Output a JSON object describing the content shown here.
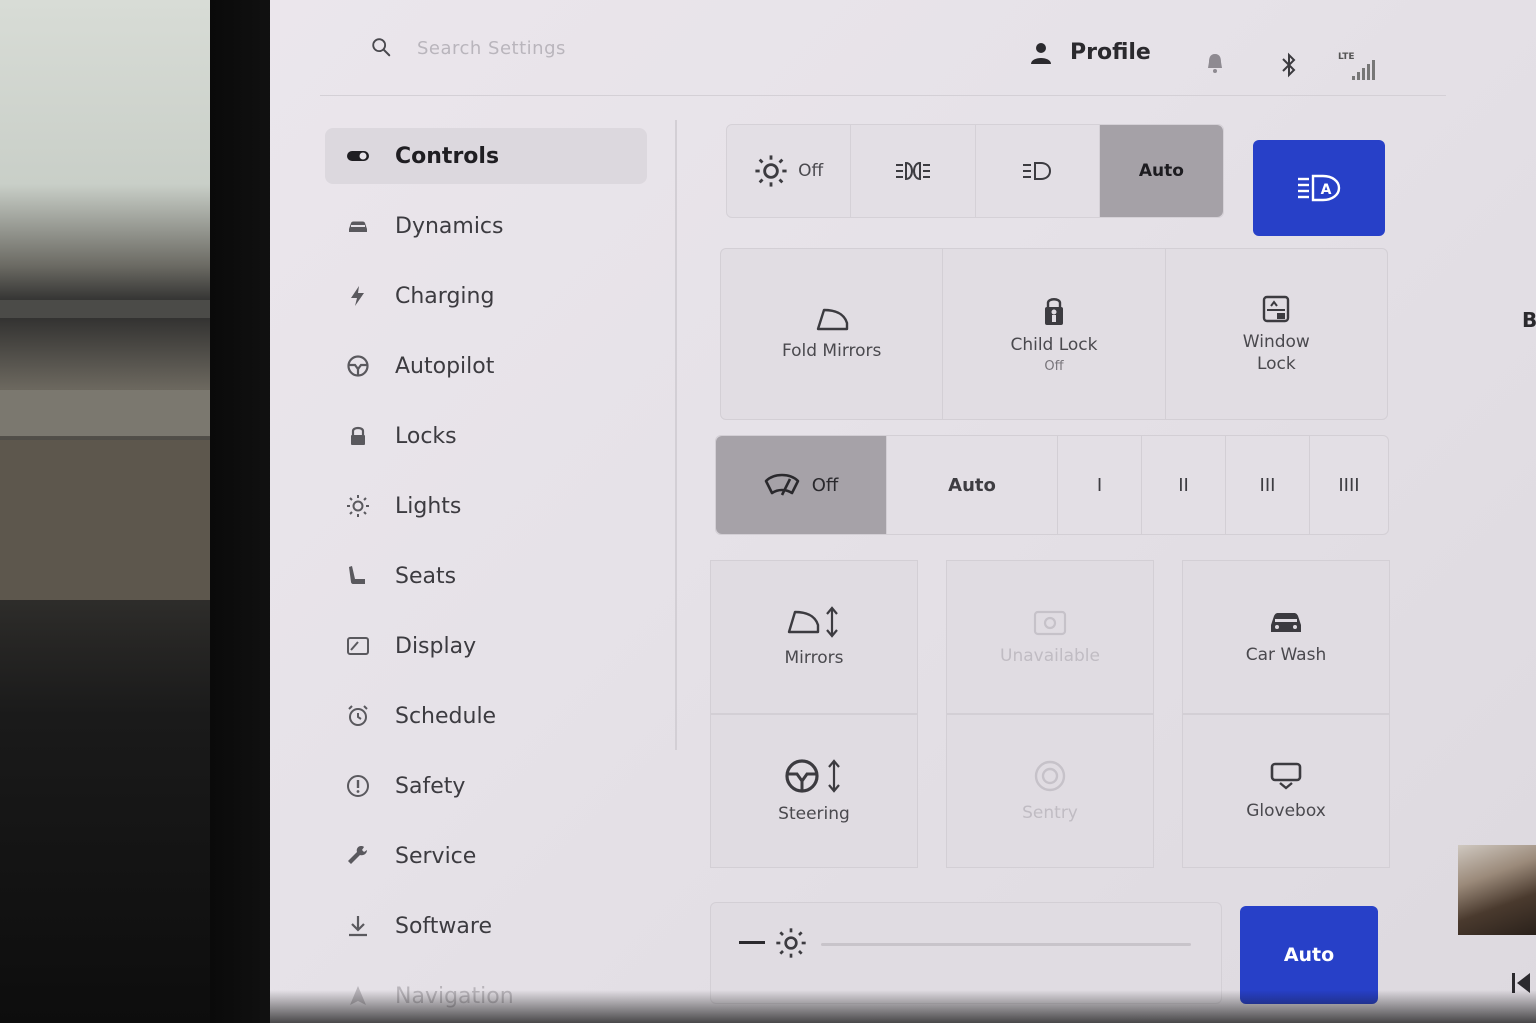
{
  "search": {
    "placeholder": "Search Settings"
  },
  "header": {
    "profile_label": "Profile",
    "signal_label": "LTE"
  },
  "sidebar": {
    "items": [
      {
        "label": "Controls",
        "icon": "toggle-icon",
        "active": true
      },
      {
        "label": "Dynamics",
        "icon": "car-icon"
      },
      {
        "label": "Charging",
        "icon": "lightning-icon"
      },
      {
        "label": "Autopilot",
        "icon": "steering-wheel-icon"
      },
      {
        "label": "Locks",
        "icon": "lock-icon"
      },
      {
        "label": "Lights",
        "icon": "sun-icon"
      },
      {
        "label": "Seats",
        "icon": "seat-icon"
      },
      {
        "label": "Display",
        "icon": "display-icon"
      },
      {
        "label": "Schedule",
        "icon": "alarm-clock-icon"
      },
      {
        "label": "Safety",
        "icon": "alert-icon"
      },
      {
        "label": "Service",
        "icon": "wrench-icon"
      },
      {
        "label": "Software",
        "icon": "download-icon"
      },
      {
        "label": "Navigation",
        "icon": "navigation-icon"
      }
    ]
  },
  "lights": {
    "segments": [
      {
        "label": "Off",
        "icon": "sun-icon"
      },
      {
        "label": "",
        "icon": "parking-lights-icon"
      },
      {
        "label": "",
        "icon": "headlight-icon"
      },
      {
        "label": "Auto",
        "icon": "",
        "selected": true
      }
    ],
    "auto_high_beam_icon": "auto-high-beam-icon"
  },
  "toggles": [
    {
      "label": "Fold Mirrors",
      "sub": "",
      "icon": "mirror-icon"
    },
    {
      "label": "Child Lock",
      "sub": "Off",
      "icon": "child-lock-icon"
    },
    {
      "label": "Window",
      "label2": "Lock",
      "icon": "window-lock-icon"
    }
  ],
  "wipers": {
    "segments": [
      {
        "label": "Off",
        "icon": "wiper-icon",
        "selected": true
      },
      {
        "label": "Auto"
      },
      {
        "label": "I"
      },
      {
        "label": "II"
      },
      {
        "label": "III"
      },
      {
        "label": "IIII"
      }
    ]
  },
  "controls_grid": [
    {
      "label": "Mirrors",
      "icon": "mirror-adjust-icon",
      "enabled": true
    },
    {
      "label": "Unavailable",
      "icon": "camera-icon",
      "enabled": false
    },
    {
      "label": "Car Wash",
      "icon": "car-wash-icon",
      "enabled": true
    },
    {
      "label": "Steering",
      "icon": "steering-adjust-icon",
      "enabled": true
    },
    {
      "label": "Sentry",
      "icon": "sentry-icon",
      "enabled": false
    },
    {
      "label": "Glovebox",
      "icon": "glovebox-icon",
      "enabled": true
    }
  ],
  "brightness": {
    "auto_label": "Auto",
    "level": 0.0
  },
  "right_overflow": {
    "letter": "B"
  },
  "colors": {
    "accent_blue": "#2740c8",
    "selected_gray": "#a5a1a7",
    "screen_bg": "#e8e4ea"
  }
}
